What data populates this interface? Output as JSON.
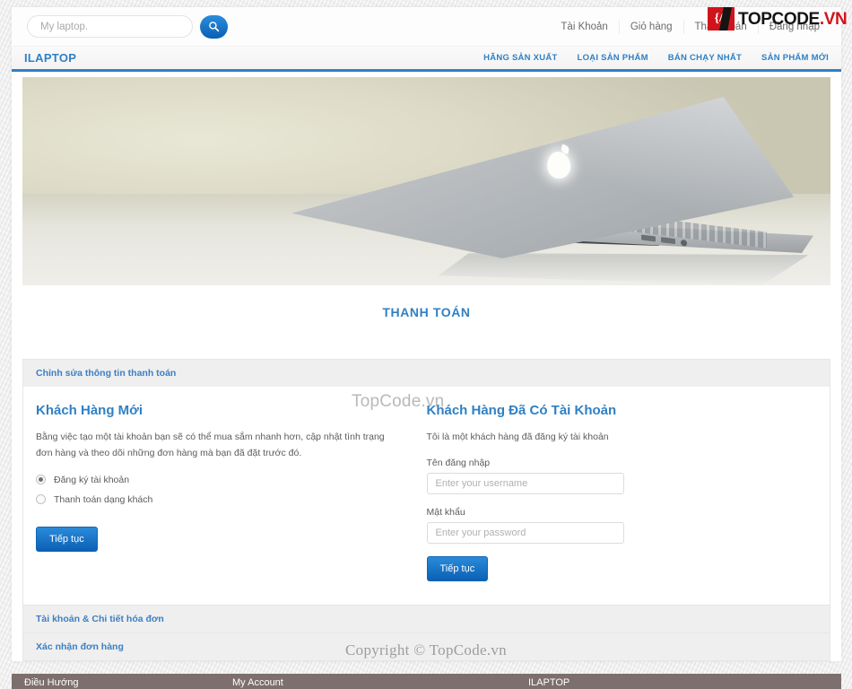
{
  "search": {
    "placeholder": "My laptop.",
    "button_icon": "search-icon"
  },
  "top_links": [
    {
      "label": "Tài Khoản"
    },
    {
      "label": "Giỏ hàng"
    },
    {
      "label": "Thanh toán"
    },
    {
      "label": "Đăng nhập"
    }
  ],
  "brand": "ILAPTOP",
  "main_nav": [
    {
      "label": "HÃNG SẢN XUẤT"
    },
    {
      "label": "LOẠI SẢN PHẨM"
    },
    {
      "label": "BÁN CHẠY NHẤT"
    },
    {
      "label": "SẢN PHẨM MỚI"
    }
  ],
  "banner": {
    "alt": "macbook-air-banner"
  },
  "page_title": "THANH TOÁN",
  "accordion": [
    {
      "header": "Chỉnh sửa thông tin thanh toán",
      "open": true
    },
    {
      "header": "Tài khoản & Chi tiết hóa đơn",
      "open": false
    },
    {
      "header": "Xác nhận đơn hàng",
      "open": false
    }
  ],
  "new_customer": {
    "title": "Khách Hàng Mới",
    "description": "Bằng việc tạo một tài khoản bạn sẽ có thể mua sắm nhanh hơn, cập nhật tình trạng đơn hàng và theo dõi những đơn hàng mà bạn đã đặt trước đó.",
    "options": [
      {
        "label": "Đăng ký tài khoản",
        "selected": true
      },
      {
        "label": "Thanh toán dạng khách",
        "selected": false
      }
    ],
    "submit": "Tiếp tục"
  },
  "returning_customer": {
    "title": "Khách Hàng Đã Có Tài Khoản",
    "description": "Tôi là một khách hàng đã đăng ký tài khoản",
    "username_label": "Tên đăng nhập",
    "username_placeholder": "Enter your username",
    "username_value": "",
    "password_label": "Mật khẩu",
    "password_placeholder": "Enter your password",
    "password_value": "",
    "submit": "Tiếp tục"
  },
  "copyright": "Copyright © TopCode.vn",
  "footer": {
    "col1_title": "Điều Hướng",
    "col2_title": "My Account",
    "col3_title": "ILAPTOP"
  },
  "watermark": {
    "center": "TopCode.vn",
    "logo_badge": "{/}",
    "logo_text_1": "TOPCODE",
    "logo_text_2": ".VN"
  },
  "colors": {
    "accent": "#2f80c4",
    "button": "#0b60b5",
    "footer_bg": "#7d6f6d",
    "watermark_red": "#d0141b"
  }
}
